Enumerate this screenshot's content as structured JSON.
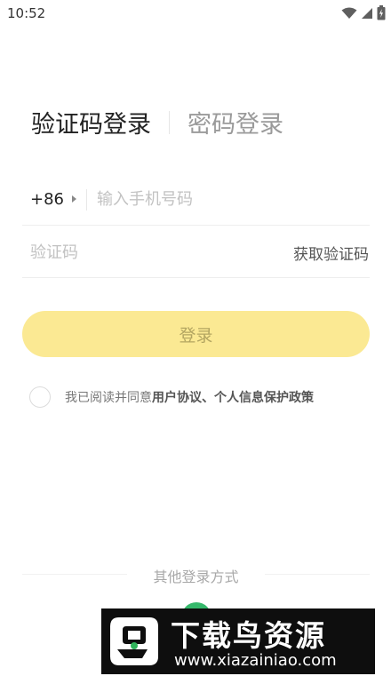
{
  "status_bar": {
    "time": "10:52"
  },
  "tabs": {
    "active": "验证码登录",
    "inactive": "密码登录"
  },
  "phone": {
    "country_code": "+86",
    "placeholder": "输入手机号码"
  },
  "code": {
    "placeholder": "验证码",
    "get_code_label": "获取验证码"
  },
  "login_button": {
    "label": "登录"
  },
  "agreement": {
    "prefix": "我已阅读并同意",
    "link": "用户协议、个人信息保护政策",
    "checked": false
  },
  "other_login": {
    "label": "其他登录方式"
  },
  "watermark": {
    "title": "下载鸟资源",
    "url": "www.xiazainiao.com"
  },
  "colors": {
    "button_bg": "#fbe993",
    "button_text": "#b3a561",
    "wechat_green": "#35b86b"
  }
}
